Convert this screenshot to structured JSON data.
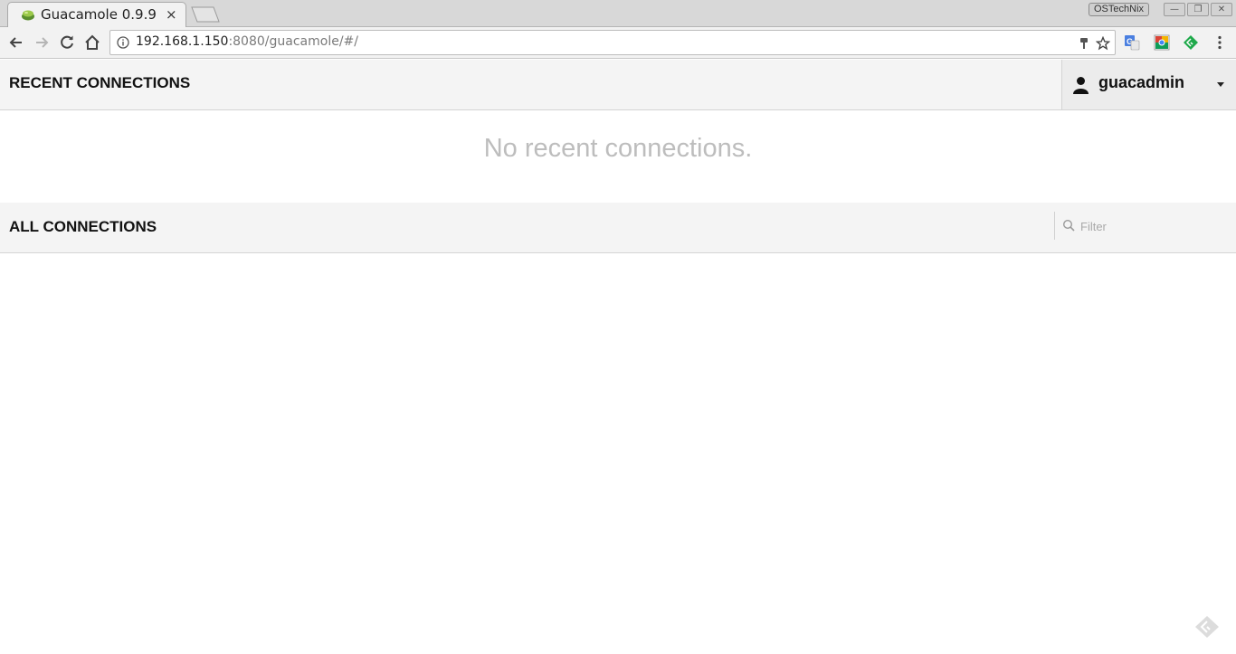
{
  "browser": {
    "tab": {
      "title": "Guacamole 0.9.9",
      "close": "×"
    },
    "brand_badge": "OSTechNix",
    "window_buttons": {
      "minimize": "—",
      "restore": "❐",
      "close": "✕"
    },
    "url": {
      "host": "192.168.1.150",
      "rest": ":8080/guacamole/#/"
    }
  },
  "page": {
    "recent": {
      "title": "RECENT CONNECTIONS",
      "empty_message": "No recent connections."
    },
    "user_menu": {
      "username": "guacadmin"
    },
    "all": {
      "title": "ALL CONNECTIONS",
      "filter_placeholder": "Filter"
    }
  },
  "colors": {
    "header_bg": "#f4f4f4",
    "empty_text": "#bdbdbd",
    "extension_green": "#1fa94b",
    "translate_blue": "#4a7fe0"
  }
}
